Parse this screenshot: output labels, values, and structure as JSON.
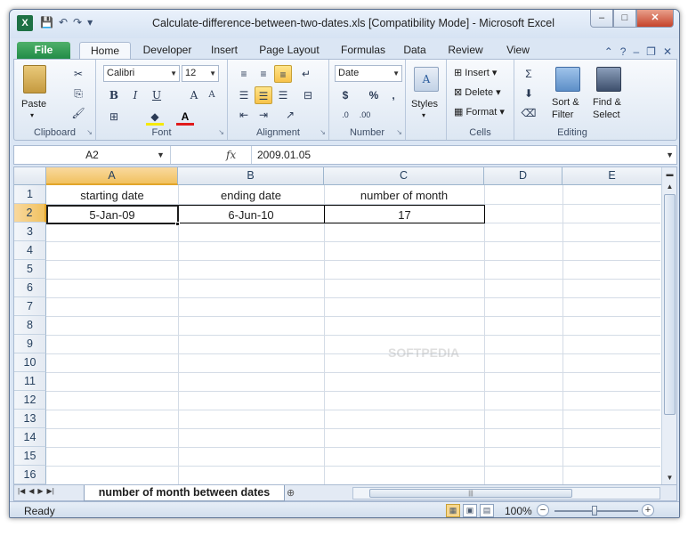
{
  "window": {
    "title": "Calculate-difference-between-two-dates.xls  [Compatibility Mode]  -  Microsoft Excel",
    "app_icon": "X",
    "min_label": "–",
    "max_label": "□",
    "close_label": "✕"
  },
  "ribbon_tabs": [
    "File",
    "Home",
    "Developer",
    "Insert",
    "Page Layout",
    "Formulas",
    "Data",
    "Review",
    "View"
  ],
  "clipboard": {
    "paste_label": "Paste",
    "group_label": "Clipboard"
  },
  "font": {
    "name": "Calibri",
    "size": "12",
    "group_label": "Font"
  },
  "alignment": {
    "group_label": "Alignment"
  },
  "number": {
    "format": "Date",
    "currency": "$",
    "percent": "%",
    "comma": ",",
    "group_label": "Number"
  },
  "styles": {
    "label": "Styles"
  },
  "cells": {
    "insert_label": "Insert",
    "delete_label": "Delete",
    "format_label": "Format",
    "group_label": "Cells"
  },
  "editing": {
    "sort_label": "Sort &",
    "sort_label2": "Filter",
    "find_label": "Find &",
    "find_label2": "Select",
    "group_label": "Editing"
  },
  "formula_bar": {
    "name_box": "A2",
    "fx": "fx",
    "value": "2009.01.05"
  },
  "columns": [
    "A",
    "B",
    "C",
    "D",
    "E"
  ],
  "rows": [
    "1",
    "2",
    "3",
    "4",
    "5",
    "6",
    "7",
    "8",
    "9",
    "10",
    "11",
    "12",
    "13",
    "14",
    "15",
    "16"
  ],
  "table": {
    "headers": [
      "starting date",
      "ending date",
      "number of month"
    ],
    "row": [
      "5-Jan-09",
      "6-Jun-10",
      "17"
    ]
  },
  "sheet_tab": "number of month between dates",
  "status": {
    "ready": "Ready",
    "zoom": "100%"
  },
  "colors": {
    "accent_file": "#1f8a45",
    "selected_header": "#f1c15f"
  }
}
